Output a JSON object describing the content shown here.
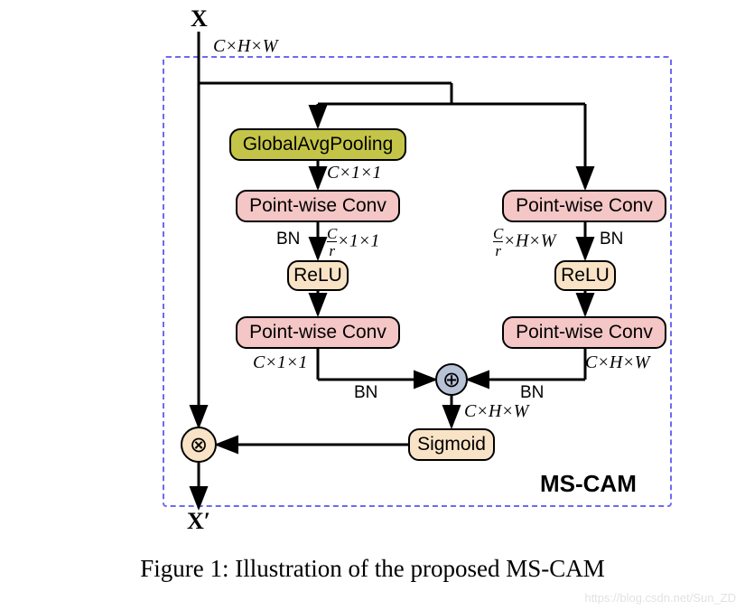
{
  "input_symbol": "X",
  "output_symbol": "X′",
  "module_name": "MS-CAM",
  "caption": "Figure 1: Illustration of the proposed MS-CAM",
  "watermark": "https://blog.csdn.net/Sun_ZD",
  "blocks": {
    "gap": "GlobalAvgPooling",
    "pwconv": "Point-wise Conv",
    "relu": "ReLU",
    "sigmoid": "Sigmoid"
  },
  "ops": {
    "add": "⊕",
    "mul": "⊗"
  },
  "annotations": {
    "bn": "BN",
    "chw": "C×H×W",
    "c11": "C×1×1",
    "cr11_num": "C",
    "cr11_den": "r",
    "cr11_tail": "×1×1",
    "crhw_tail": "×H×W"
  }
}
